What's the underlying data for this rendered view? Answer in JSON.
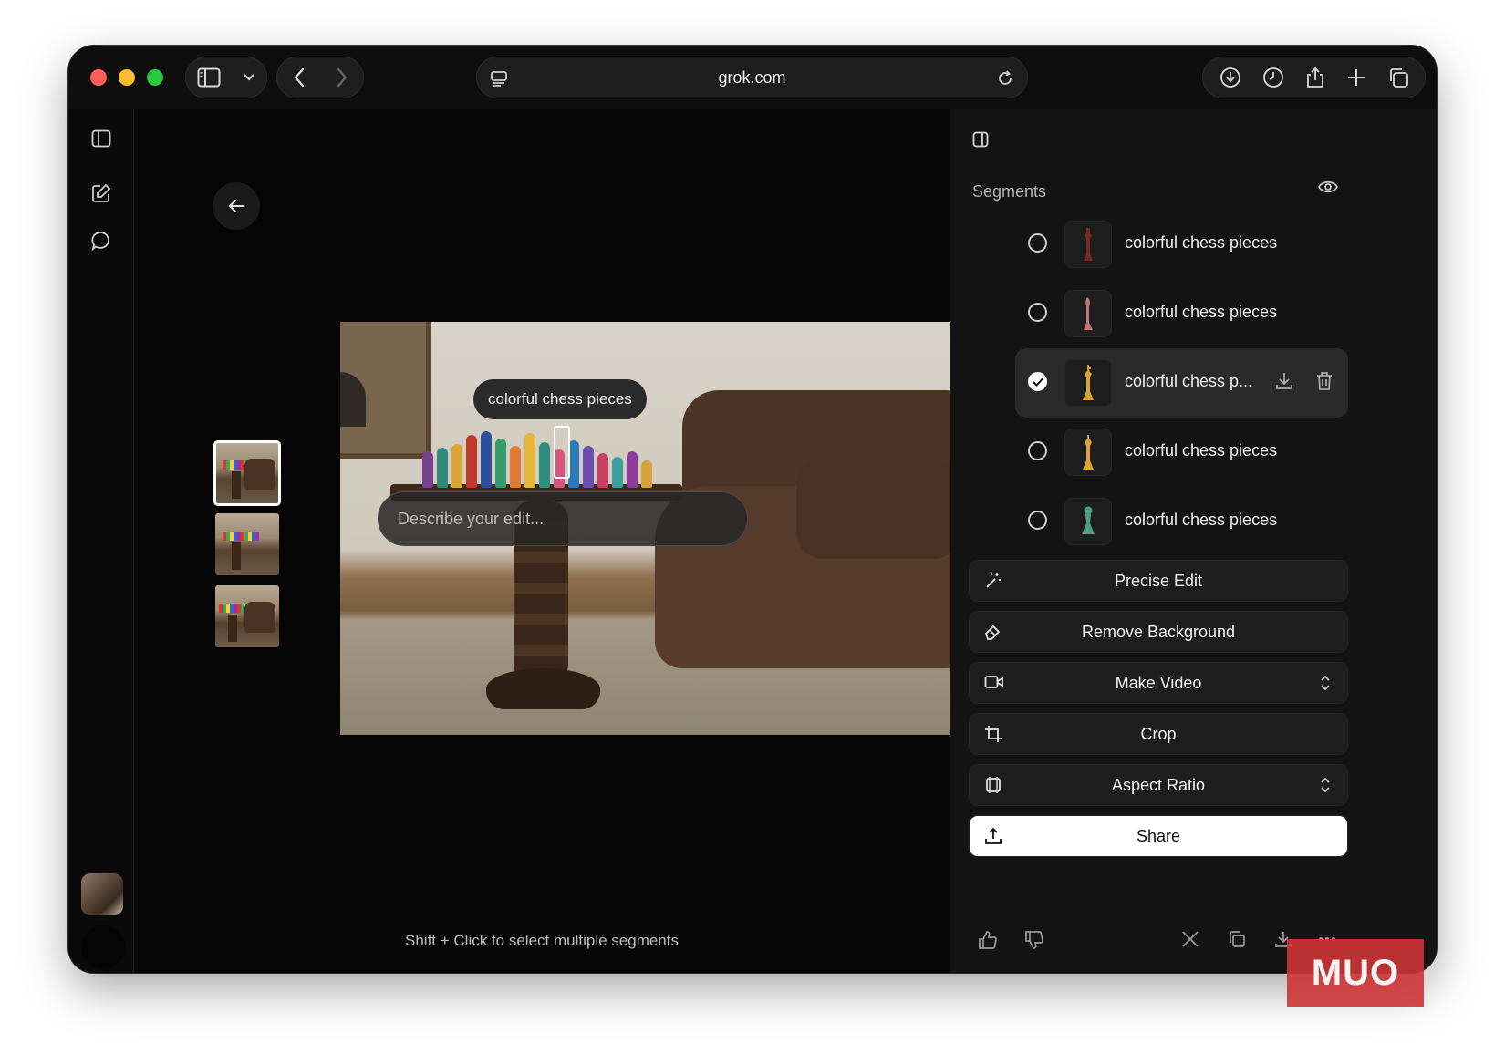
{
  "browser": {
    "url": "grok.com"
  },
  "canvas": {
    "segment_tooltip": "colorful chess pieces",
    "edit_placeholder": "Describe your edit...",
    "hint": "Shift + Click to select multiple segments",
    "thumbnails": [
      "thumbnail-1",
      "thumbnail-2",
      "thumbnail-3"
    ]
  },
  "panel": {
    "segments_title": "Segments",
    "segments": [
      {
        "label": "colorful chess pieces",
        "selected": false,
        "color": "#7a2a22"
      },
      {
        "label": "colorful chess pieces",
        "selected": false,
        "color": "#c9737a"
      },
      {
        "label": "colorful chess p...",
        "selected": true,
        "color": "#d9a231"
      },
      {
        "label": "colorful chess pieces",
        "selected": false,
        "color": "#e0a135"
      },
      {
        "label": "colorful chess pieces",
        "selected": false,
        "color": "#4f9e86"
      }
    ],
    "actions": {
      "precise_edit": "Precise Edit",
      "remove_background": "Remove Background",
      "make_video": "Make Video",
      "crop": "Crop",
      "aspect_ratio": "Aspect Ratio",
      "share": "Share"
    }
  },
  "watermark": "MUO",
  "colors": {
    "window_bg": "#0a0a0a",
    "panel_bg": "#141414",
    "accent_white": "#ffffff",
    "watermark_red": "#cd3434"
  }
}
